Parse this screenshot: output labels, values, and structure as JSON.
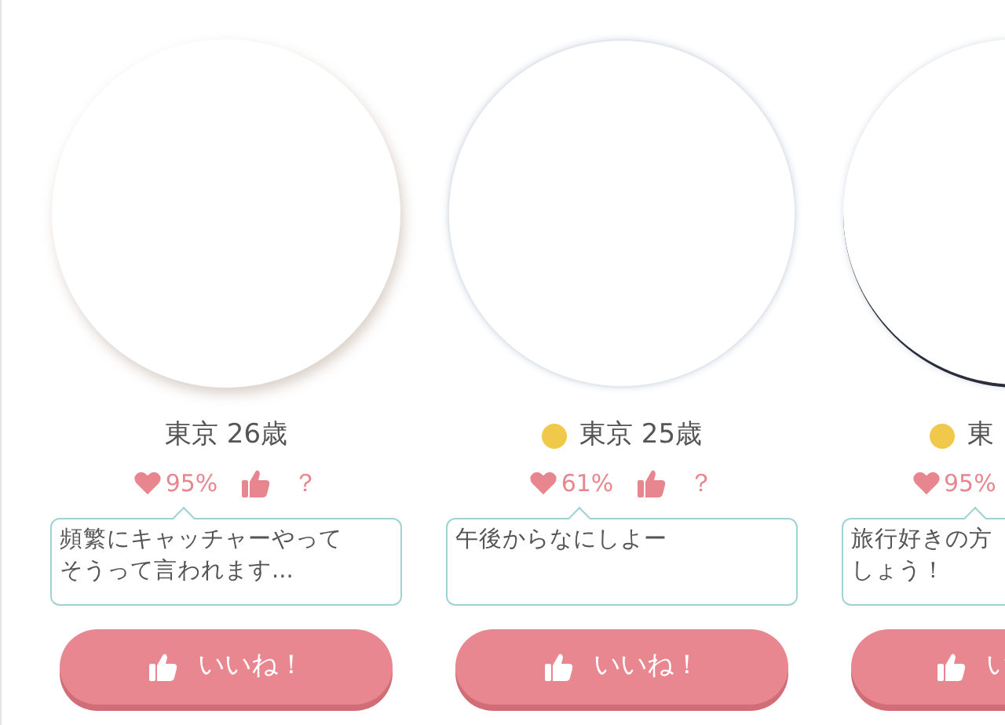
{
  "cards": [
    {
      "location_age": "東京 26歳",
      "online": false,
      "match": "95%",
      "comment_lines": [
        "頻繁にキャッチャーやって",
        "そうって言われます..."
      ],
      "button": "いいね！",
      "question": "？"
    },
    {
      "location_age": "東京 25歳",
      "online": true,
      "match": "61%",
      "comment_lines": [
        "午後からなにしよー"
      ],
      "button": "いいね！",
      "question": "？"
    },
    {
      "location_age": "東",
      "online": true,
      "match": "95%",
      "comment_lines": [
        "旅行好きの方",
        "しょう！"
      ],
      "button": "い"
    }
  ]
}
